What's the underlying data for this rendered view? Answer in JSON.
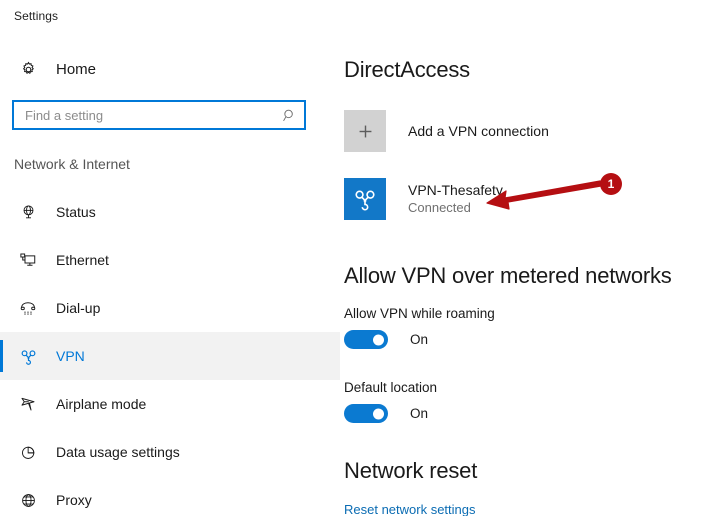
{
  "window": {
    "title": "Settings"
  },
  "sidebar": {
    "home": {
      "label": "Home",
      "icon": "gear-icon"
    },
    "search": {
      "placeholder": "Find a setting",
      "value": "",
      "icon": "search-icon"
    },
    "category_label": "Network & Internet",
    "items": [
      {
        "label": "Status",
        "icon": "globe-monitor-icon",
        "selected": false
      },
      {
        "label": "Ethernet",
        "icon": "ethernet-icon",
        "selected": false
      },
      {
        "label": "Dial-up",
        "icon": "dialup-phone-icon",
        "selected": false
      },
      {
        "label": "VPN",
        "icon": "vpn-knot-icon",
        "selected": true
      },
      {
        "label": "Airplane mode",
        "icon": "airplane-icon",
        "selected": false
      },
      {
        "label": "Data usage settings",
        "icon": "pie-chart-icon",
        "selected": false
      },
      {
        "label": "Proxy",
        "icon": "globe-icon",
        "selected": false
      }
    ]
  },
  "main": {
    "heading_directaccess": "DirectAccess",
    "add_vpn": {
      "label": "Add a VPN connection",
      "icon": "plus-icon"
    },
    "vpn_connection": {
      "name": "VPN-Thesafety",
      "status": "Connected",
      "icon": "vpn-knot-icon"
    },
    "heading_metered": "Allow VPN over metered networks",
    "toggles": [
      {
        "caption": "Allow VPN while roaming",
        "state": "On",
        "on": true
      },
      {
        "caption": "Default location",
        "state": "On",
        "on": true
      }
    ],
    "heading_reset": "Network reset",
    "reset_link": "Reset network settings"
  },
  "annotation": {
    "badge_number": "1",
    "color": "#b50f12"
  },
  "colors": {
    "accent_blue": "#0078d7",
    "tile_blue": "#1278c8",
    "toggle_blue": "#0b7ad1",
    "tile_gray": "#d2d2d2",
    "annotation_red": "#b50f12"
  }
}
